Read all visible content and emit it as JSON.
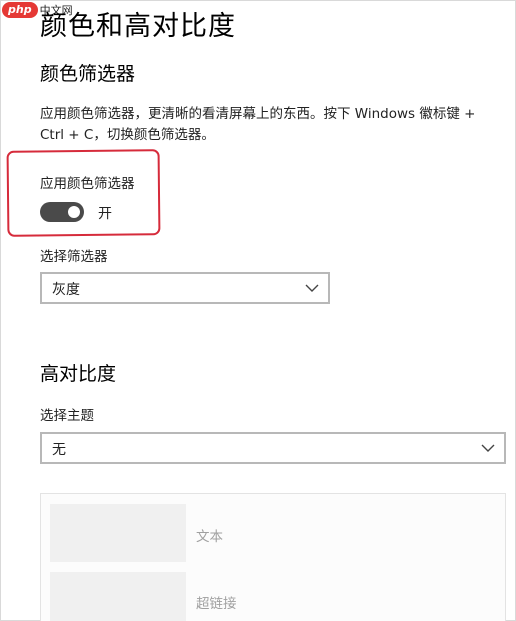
{
  "watermark": {
    "badge": "php",
    "site": "中文网"
  },
  "page": {
    "title": "颜色和高对比度"
  },
  "color_filter": {
    "section_title": "颜色筛选器",
    "description": "应用颜色筛选器，更清晰的看清屏幕上的东西。按下 Windows 徽标键 + Ctrl + C，切换颜色筛选器。",
    "toggle_label": "应用颜色筛选器",
    "toggle_state": "开",
    "toggle_on": true,
    "select_label": "选择筛选器",
    "select_value": "灰度"
  },
  "high_contrast": {
    "section_title": "高对比度",
    "theme_label": "选择主题",
    "theme_value": "无",
    "preview": {
      "text_label": "文本",
      "link_label": "超链接"
    }
  },
  "colors": {
    "annotation_red": "#d62b3b",
    "toggle_on": "#4a4a4a"
  }
}
